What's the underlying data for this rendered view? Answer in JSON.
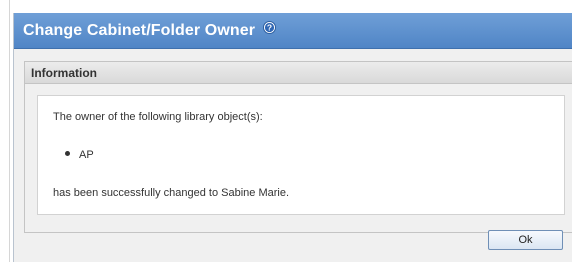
{
  "dialog": {
    "title": "Change Cabinet/Folder Owner",
    "help_icon": "help-icon"
  },
  "section": {
    "title": "Information"
  },
  "message": {
    "intro": "The owner of the following library object(s):",
    "items": [
      "AP"
    ],
    "result": "has been successfully changed to Sabine Marie."
  },
  "buttons": {
    "ok_label": "Ok"
  },
  "colors": {
    "titlebar": "#5085c6",
    "button_border": "#6f8fb6"
  }
}
